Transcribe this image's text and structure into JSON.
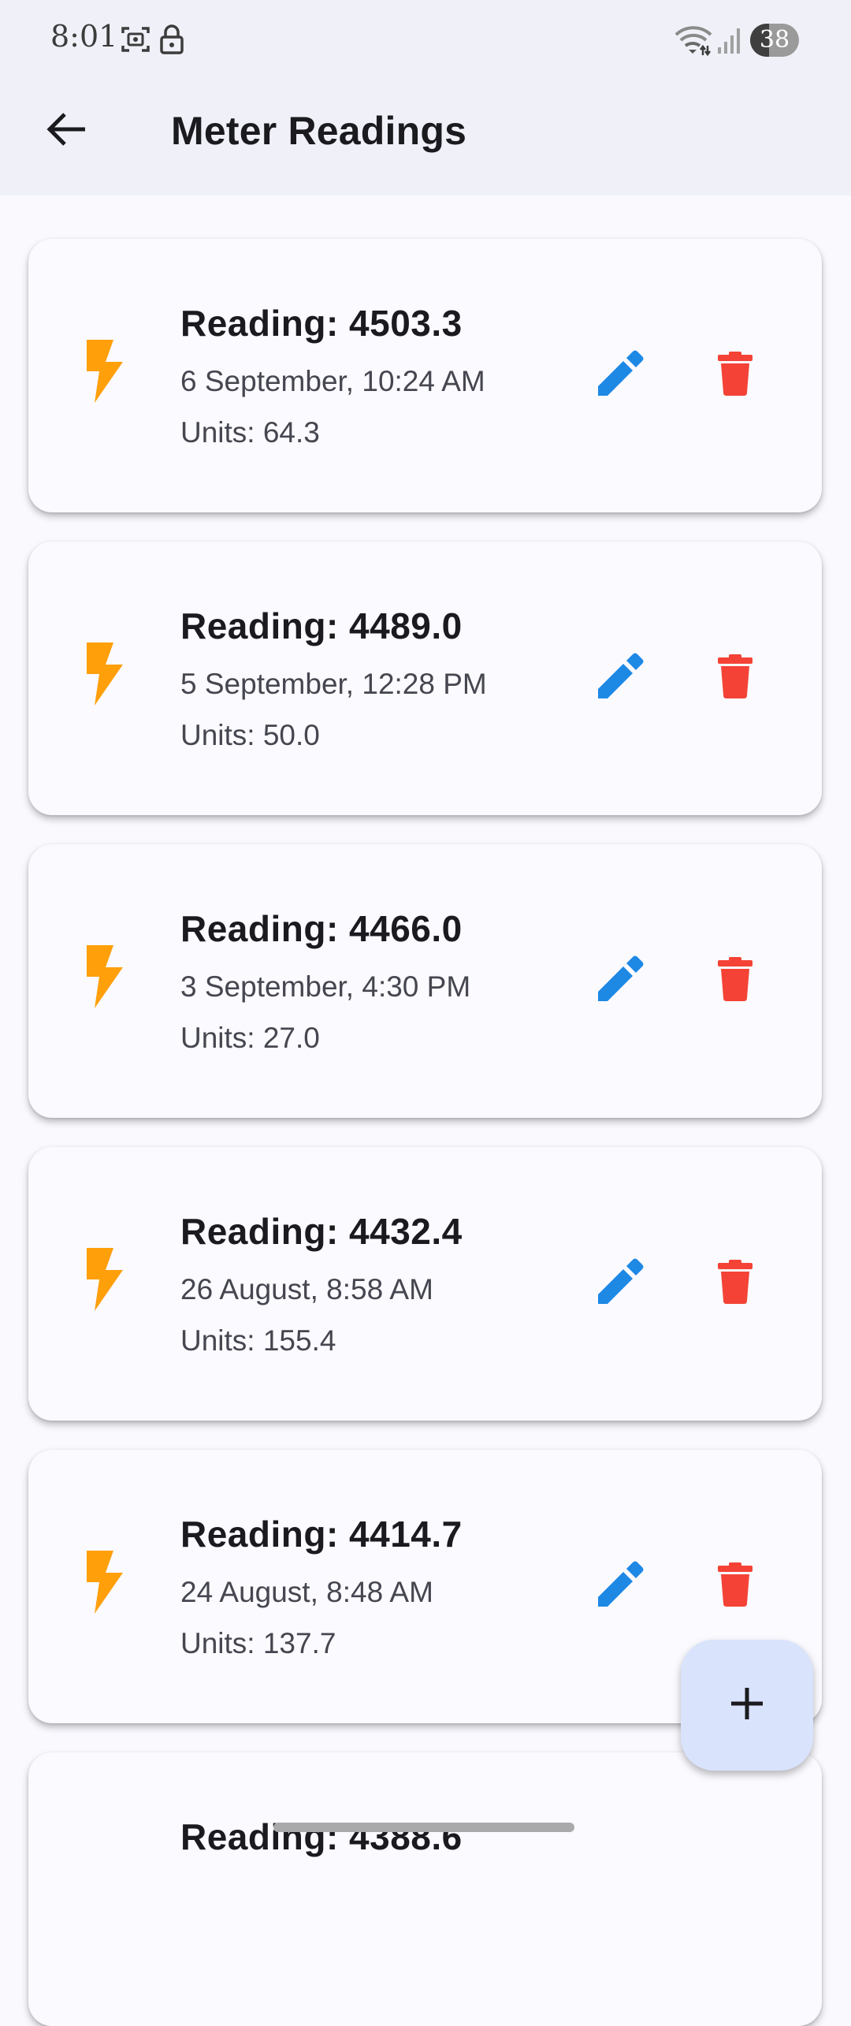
{
  "status_bar": {
    "time": "8:01",
    "icons": [
      "screenshot-icon",
      "lock-icon",
      "wifi-icon",
      "signal-icon"
    ],
    "battery_level": "38",
    "battery_fraction": 0.38
  },
  "app_bar": {
    "back_icon": "arrow-back-icon",
    "title": "Meter Readings"
  },
  "readings": [
    {
      "title": "Reading: 4503.3",
      "date": "6 September, 10:24 AM",
      "units": "Units: 64.3"
    },
    {
      "title": "Reading: 4489.0",
      "date": "5 September, 12:28 PM",
      "units": "Units: 50.0"
    },
    {
      "title": "Reading: 4466.0",
      "date": "3 September, 4:30 PM",
      "units": "Units: 27.0"
    },
    {
      "title": "Reading: 4432.4",
      "date": "26 August, 8:58 AM",
      "units": "Units: 155.4"
    },
    {
      "title": "Reading: 4414.7",
      "date": "24 August, 8:48 AM",
      "units": "Units: 137.7"
    },
    {
      "title": "Reading: 4388.6",
      "date": "",
      "units": ""
    }
  ],
  "icons": {
    "reading": "bolt-icon",
    "edit": "edit-icon",
    "delete": "delete-icon",
    "fab": "add-icon"
  },
  "colors": {
    "bolt": "#ff9f0a",
    "edit": "#1e88e5",
    "delete": "#f44336",
    "fab_background": "#d9e3fc",
    "app_bar_background": "#f0f1f8",
    "card_background": "#fafaff"
  }
}
